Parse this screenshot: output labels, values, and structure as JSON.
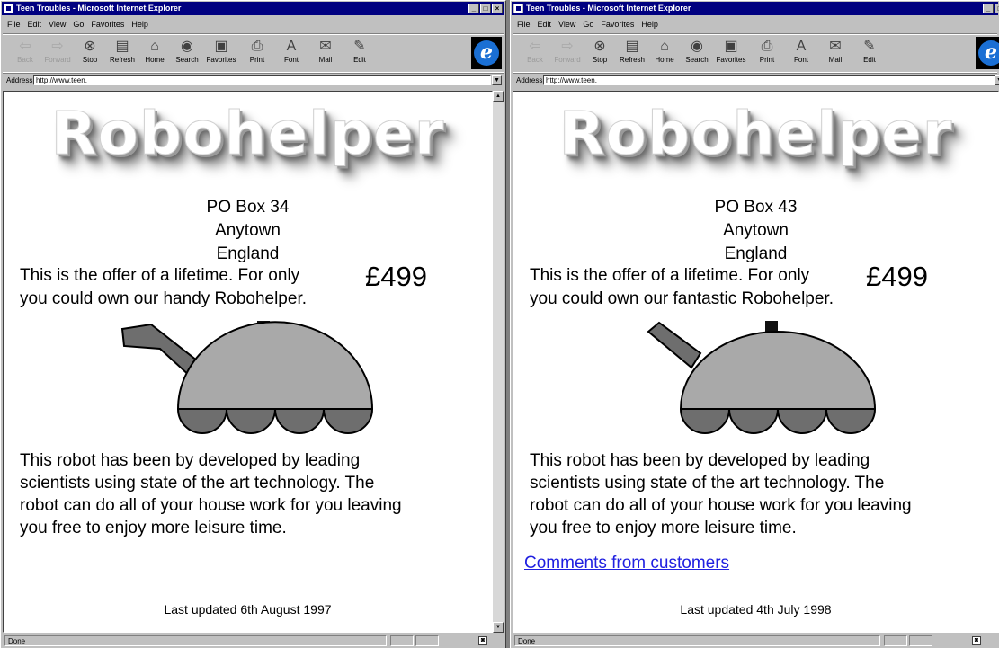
{
  "windows": [
    {
      "title": "Teen Troubles - Microsoft Internet Explorer",
      "menu": [
        "File",
        "Edit",
        "View",
        "Go",
        "Favorites",
        "Help"
      ],
      "toolbar": [
        "Back",
        "Forward",
        "Stop",
        "Refresh",
        "Home",
        "Search",
        "Favorites",
        "Print",
        "Font",
        "Mail",
        "Edit"
      ],
      "address_label": "Address",
      "address_value": "http://www.teen.",
      "page": {
        "heading": "Robohelper",
        "address_lines": [
          "PO Box 34",
          "Anytown",
          "England"
        ],
        "offer_line1": "This is the offer of a lifetime. For only",
        "price": "£499",
        "offer_line2": "you could own our handy Robohelper.",
        "description": [
          "This robot has been by developed by leading",
          "scientists using state of the art technology. The",
          "robot can do all of your house work for you leaving",
          "you free to enjoy more leisure time."
        ],
        "last_updated": "Last updated 6th August 1997"
      },
      "status": "Done"
    },
    {
      "title": "Teen Troubles - Microsoft Internet Explorer",
      "menu": [
        "File",
        "Edit",
        "View",
        "Go",
        "Favorites",
        "Help"
      ],
      "toolbar": [
        "Back",
        "Forward",
        "Stop",
        "Refresh",
        "Home",
        "Search",
        "Favorites",
        "Print",
        "Font",
        "Mail",
        "Edit"
      ],
      "address_label": "Address",
      "address_value": "http://www.teen.",
      "page": {
        "heading": "Robohelper",
        "address_lines": [
          "PO Box 43",
          "Anytown",
          "England"
        ],
        "offer_line1": "This is the offer of a lifetime. For only",
        "price": "£499",
        "offer_line2": "you could own our fantastic Robohelper.",
        "description": [
          "This robot has been by developed by leading",
          "scientists using state of the art technology. The",
          "robot can do all of your house work for you leaving",
          "you free to enjoy more leisure time."
        ],
        "comments_link": "Comments from customers",
        "last_updated": "Last updated 4th July 1998"
      },
      "status": "Done"
    }
  ],
  "icons": {
    "back": "arrow-left-icon",
    "forward": "arrow-right-icon",
    "stop": "stop-icon",
    "refresh": "refresh-icon",
    "home": "home-icon",
    "search": "search-icon",
    "favorites": "favorites-icon",
    "print": "print-icon",
    "font": "font-icon",
    "mail": "mail-icon",
    "edit": "edit-icon",
    "browser_logo": "ie-logo-icon"
  },
  "colors": {
    "titlebar": "#000080",
    "link": "#1f1fe0",
    "robot_body": "#a9a9a9",
    "robot_dark": "#6e6e6e"
  }
}
